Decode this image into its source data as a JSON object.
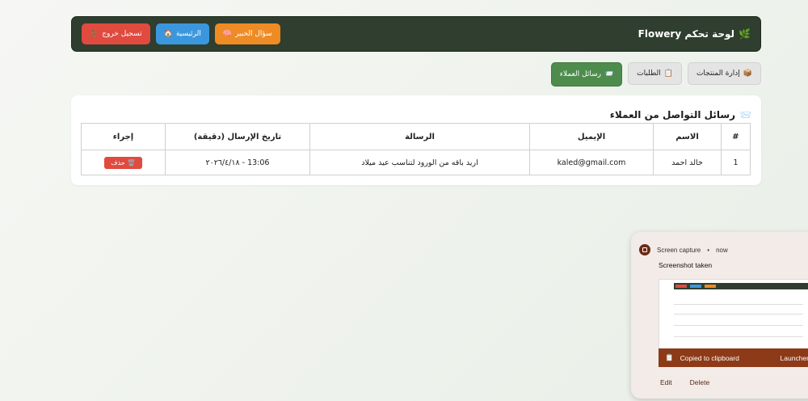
{
  "header": {
    "brand": "لوحة تحكم Flowery",
    "brand_icon": "🌿",
    "buttons": [
      {
        "label": "تسجيل خروج",
        "icon": "🚪"
      },
      {
        "label": "الرئيسية",
        "icon": "🏠"
      },
      {
        "label": "سؤال الخبير",
        "icon": "🧠"
      }
    ]
  },
  "nav": [
    {
      "label": "إدارة المنتجات",
      "icon": "📦"
    },
    {
      "label": "الطلبات",
      "icon": "📋"
    },
    {
      "label": "رسائل العملاء",
      "icon": "📨"
    }
  ],
  "messages": {
    "title": "رسائل التواصل من العملاء",
    "title_icon": "📨",
    "columns": [
      "#",
      "الاسم",
      "الإيميل",
      "الرسالة",
      "تاريخ الإرسال (دقيقة)",
      "إجراء"
    ],
    "rows": [
      {
        "num": "1",
        "name": "خالد احمد",
        "email": "kaled@gmail.com",
        "message": "اريد باقه من الورود لتناسب عيد ميلاد",
        "date": "٢٠٢٦/٤/١٨ - 13:06",
        "action": "حذف",
        "action_icon": "🗑️"
      }
    ]
  },
  "notification": {
    "app": "Screen capture",
    "time": "now",
    "title": "Screenshot taken",
    "copied": "Copied to clipboard",
    "launcher": "Launcher",
    "edit": "Edit",
    "delete": "Delete"
  },
  "colors": {
    "topbar": "#2f3e2e",
    "danger": "#e04a3f",
    "primary": "#3b97dd",
    "warning": "#ee8b25",
    "active_nav": "#4d8c4d",
    "toast_bar": "#8d3a18"
  }
}
